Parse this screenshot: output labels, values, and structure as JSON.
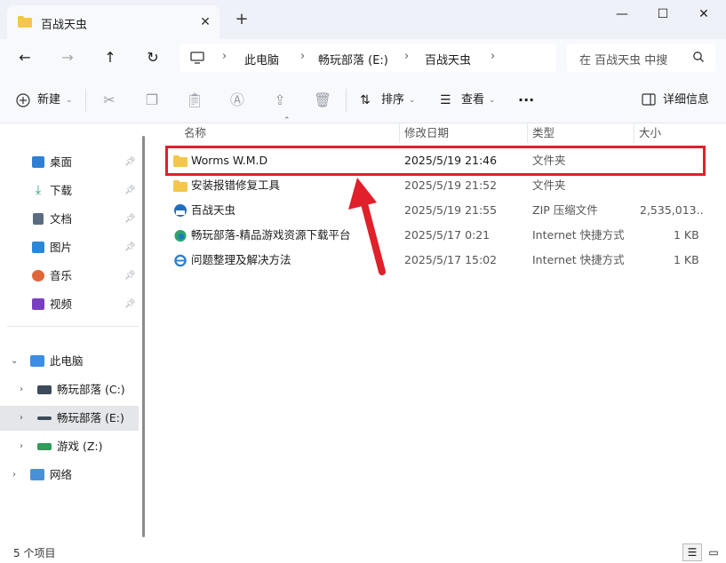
{
  "window": {
    "tab_title": "百战天虫",
    "close_tab": "✕",
    "new_tab": "+",
    "minimize": "—",
    "maximize": "☐",
    "close": "✕"
  },
  "nav": {
    "back": "←",
    "forward": "→",
    "up": "↑",
    "refresh": "↻",
    "breadcrumbs": [
      "此电脑",
      "畅玩部落 (E:)",
      "百战天虫"
    ],
    "search_placeholder": "在 百战天虫 中搜"
  },
  "toolbar": {
    "new_label": "新建",
    "sort_label": "排序",
    "view_label": "查看",
    "more": "···",
    "details_label": "详细信息"
  },
  "sidebar": {
    "quick_access": [
      {
        "label": "桌面",
        "icon": "desktop-icon",
        "color": "#2f7fd6"
      },
      {
        "label": "下载",
        "icon": "download-icon",
        "color": "#1f9e6a"
      },
      {
        "label": "文档",
        "icon": "document-icon",
        "color": "#5b6b80"
      },
      {
        "label": "图片",
        "icon": "pictures-icon",
        "color": "#2b88d8"
      },
      {
        "label": "音乐",
        "icon": "music-icon",
        "color": "#e0663a"
      },
      {
        "label": "视频",
        "icon": "video-icon",
        "color": "#7a3fbf"
      }
    ],
    "this_pc": "此电脑",
    "drives": [
      {
        "label": "畅玩部落 (C:)"
      },
      {
        "label": "畅玩部落 (E:)"
      },
      {
        "label": "游戏 (Z:)"
      }
    ],
    "network": "网络"
  },
  "columns": {
    "name": "名称",
    "modified": "修改日期",
    "type": "类型",
    "size": "大小"
  },
  "files": [
    {
      "name": "Worms W.M.D",
      "modified": "2025/5/19 21:46",
      "type": "文件夹",
      "size": "",
      "icon": "folder-icon"
    },
    {
      "name": "安装报错修复工具",
      "modified": "2025/5/19 21:52",
      "type": "文件夹",
      "size": "",
      "icon": "folder-icon"
    },
    {
      "name": "百战天虫",
      "modified": "2025/5/19 21:55",
      "type": "ZIP 压缩文件",
      "size": "2,535,013...",
      "icon": "zip-icon"
    },
    {
      "name": "畅玩部落-精品游戏资源下载平台",
      "modified": "2025/5/17 0:21",
      "type": "Internet 快捷方式",
      "size": "1 KB",
      "icon": "edge-shortcut-icon"
    },
    {
      "name": "问题整理及解决方法",
      "modified": "2025/5/17 15:02",
      "type": "Internet 快捷方式",
      "size": "1 KB",
      "icon": "ie-shortcut-icon"
    }
  ],
  "status": {
    "item_count": "5 个项目"
  },
  "colors": {
    "highlight_border": "#e0202a",
    "folder": "#f4c64a",
    "selected_bg": "#e4e6ea"
  }
}
